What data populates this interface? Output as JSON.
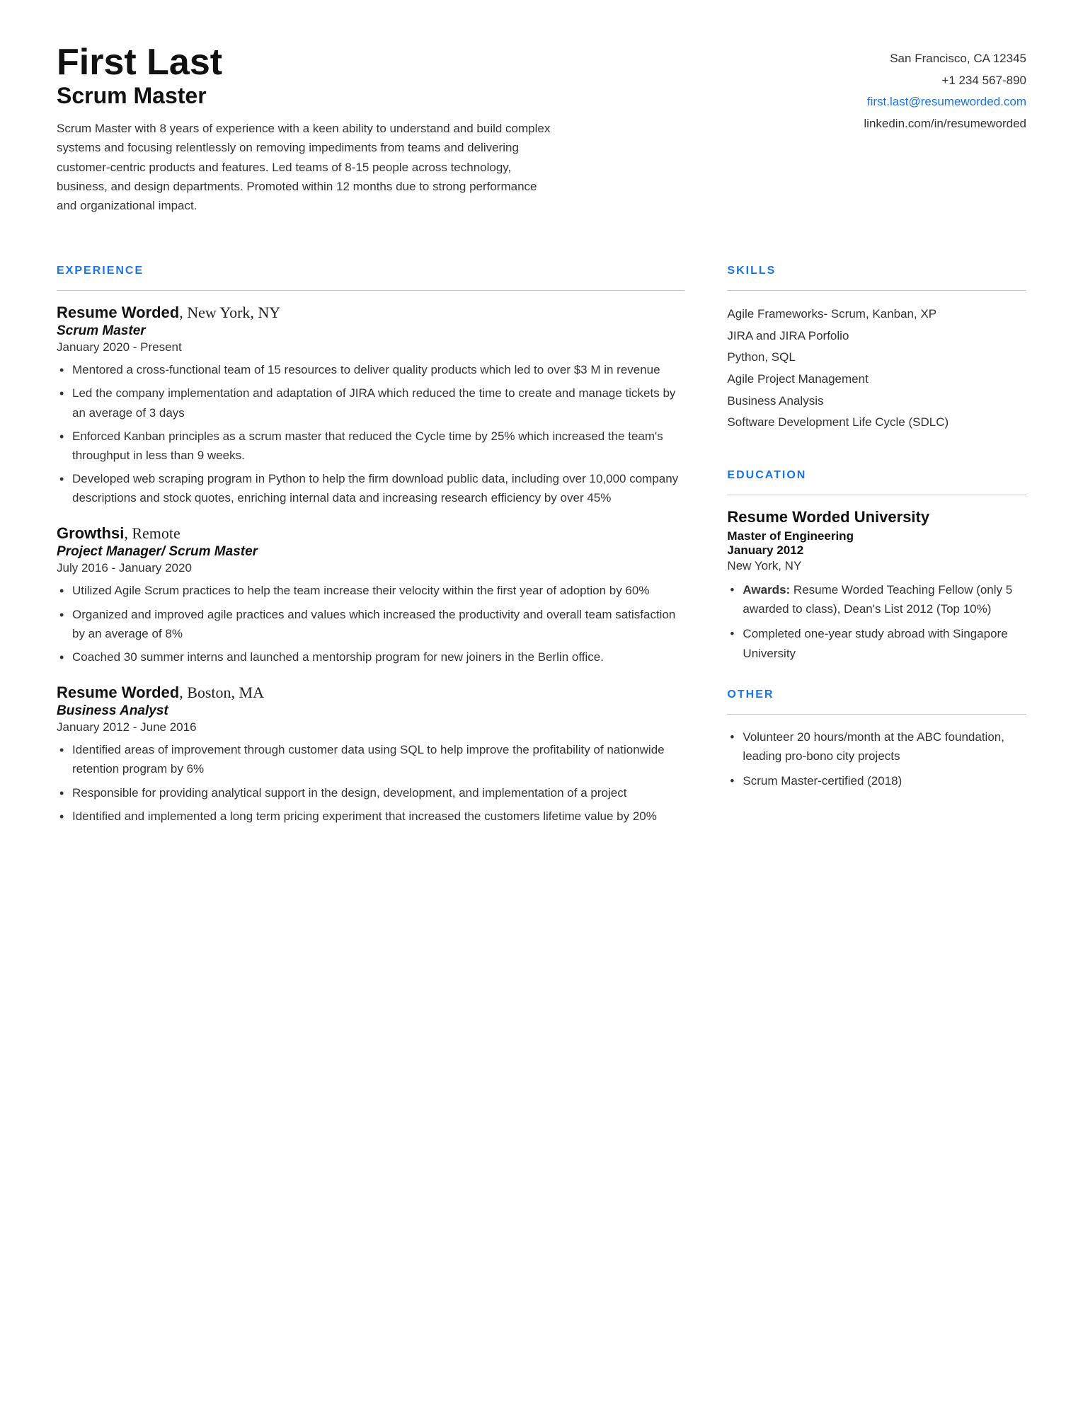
{
  "header": {
    "name": "First Last",
    "title": "Scrum Master",
    "summary": "Scrum Master with 8 years of experience with a keen ability to understand and build complex systems and focusing relentlessly on removing impediments from teams and delivering customer-centric products and features. Led teams of 8-15 people across technology, business, and design departments. Promoted within 12 months due to strong performance and organizational impact.",
    "contact": {
      "address": "San Francisco, CA 12345",
      "phone": "+1 234 567-890",
      "email": "first.last@resumeworded.com",
      "linkedin": "linkedin.com/in/resumeworded"
    }
  },
  "sections": {
    "experience_label": "EXPERIENCE",
    "skills_label": "SKILLS",
    "education_label": "EDUCATION",
    "other_label": "OTHER"
  },
  "experience": [
    {
      "company": "Resume Worded",
      "company_suffix": ", New York, NY",
      "role": "Scrum Master",
      "dates": "January 2020 - Present",
      "bullets": [
        "Mentored a cross-functional team of 15 resources to deliver quality products which led to over $3 M in revenue",
        "Led the company implementation and adaptation of JIRA which reduced the time to create and manage tickets by an average of 3 days",
        "Enforced Kanban principles as a scrum master that reduced the Cycle time by 25% which increased the team's throughput in less than 9 weeks.",
        "Developed web scraping program in Python to help the firm download public data, including over 10,000 company descriptions and stock quotes, enriching internal data and increasing research efficiency by over 45%"
      ]
    },
    {
      "company": "Growthsi",
      "company_suffix": ", Remote",
      "role": "Project Manager/ Scrum Master",
      "dates": "July 2016 - January 2020",
      "bullets": [
        "Utilized Agile Scrum practices to help the team increase their velocity within the first year of adoption by 60%",
        "Organized and improved agile practices and values which increased the productivity and overall team satisfaction by an average of 8%",
        "Coached 30 summer interns and launched a mentorship program for new joiners in the Berlin office."
      ]
    },
    {
      "company": "Resume Worded",
      "company_suffix": ", Boston, MA",
      "role": "Business Analyst",
      "dates": "January 2012 - June 2016",
      "bullets": [
        "Identified areas of improvement through customer data using SQL to help improve the profitability of nationwide retention program by 6%",
        "Responsible for providing analytical support in the design, development, and implementation of a project",
        "Identified and implemented a long term pricing experiment that increased the customers lifetime value by 20%"
      ]
    }
  ],
  "skills": [
    "Agile Frameworks- Scrum, Kanban, XP",
    "JIRA and JIRA Porfolio",
    "Python, SQL",
    "Agile Project Management",
    "Business Analysis",
    "Software Development Life Cycle (SDLC)"
  ],
  "education": {
    "school": "Resume Worded University",
    "degree": "Master of Engineering",
    "date": "January 2012",
    "location": "New York, NY",
    "bullets": [
      {
        "bold_part": "Awards:",
        "text": " Resume Worded Teaching Fellow (only 5 awarded to class), Dean's List 2012 (Top 10%)"
      },
      {
        "bold_part": "",
        "text": "Completed one-year study abroad with Singapore University"
      }
    ]
  },
  "other": [
    "Volunteer 20 hours/month at the ABC foundation, leading pro-bono city projects",
    "Scrum Master-certified (2018)"
  ]
}
